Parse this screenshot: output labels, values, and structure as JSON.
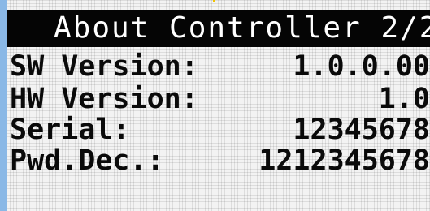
{
  "header": {
    "title": "About Controller 2/2"
  },
  "rows": [
    {
      "label": "SW Version:",
      "value": "1.0.0.00"
    },
    {
      "label": "HW Version:",
      "value": "1.0"
    },
    {
      "label": "Serial:",
      "value": "12345678"
    },
    {
      "label": "Pwd.Dec.:",
      "value": "1212345678"
    }
  ],
  "colors": {
    "title_bar_bg": "#050505",
    "title_text": "#ffffff",
    "lcd_background": "#f3f3f3",
    "text": "#0a0a0a",
    "left_edge": "#8ab8e6"
  }
}
